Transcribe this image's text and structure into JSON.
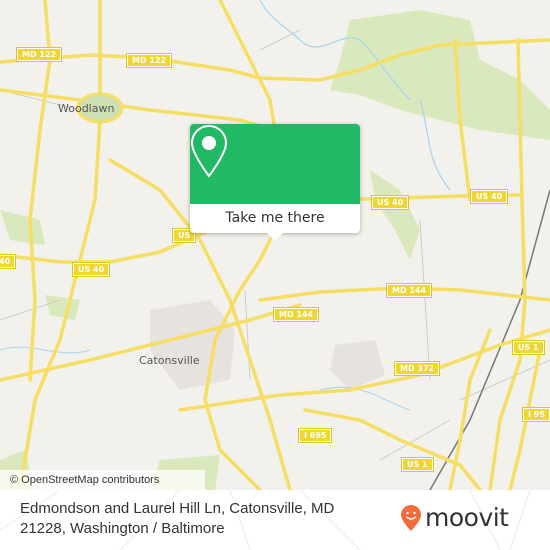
{
  "map": {
    "attribution": "© OpenStreetMap contributors",
    "route_shields": [
      {
        "id": "md122-west",
        "label": "MD 122"
      },
      {
        "id": "md122-east",
        "label": "MD 122"
      },
      {
        "id": "us40-west",
        "label": "40"
      },
      {
        "id": "us40-central",
        "label": "US 40"
      },
      {
        "id": "us40-partial",
        "label": "US"
      },
      {
        "id": "us40-east1",
        "label": "US 40"
      },
      {
        "id": "us40-east2",
        "label": "US 40"
      },
      {
        "id": "md144-west",
        "label": "MD 144"
      },
      {
        "id": "md144-east",
        "label": "MD 144"
      },
      {
        "id": "md372",
        "label": "MD 372"
      },
      {
        "id": "i695",
        "label": "I 695"
      },
      {
        "id": "us1-north",
        "label": "US 1"
      },
      {
        "id": "us1-south",
        "label": "US 1"
      },
      {
        "id": "i95",
        "label": "I 95"
      }
    ],
    "places": [
      {
        "id": "woodlawn",
        "label": "Woodlawn"
      },
      {
        "id": "catonsville",
        "label": "Catonsville"
      }
    ],
    "colors": {
      "background": "#f2f1ec",
      "road": "#f6de63",
      "park": "#d9e9bd",
      "water": "#a7d3ef",
      "urban": "#e8e2de"
    }
  },
  "popup": {
    "icon": "location-pin-icon",
    "button_label": "Take me there",
    "accent": "#21b866"
  },
  "footer": {
    "address": "Edmondson and Laurel Hill Ln, Catonsville, MD 21228, Washington / Baltimore",
    "brand": "moovit",
    "brand_color": "#f26b3a"
  }
}
